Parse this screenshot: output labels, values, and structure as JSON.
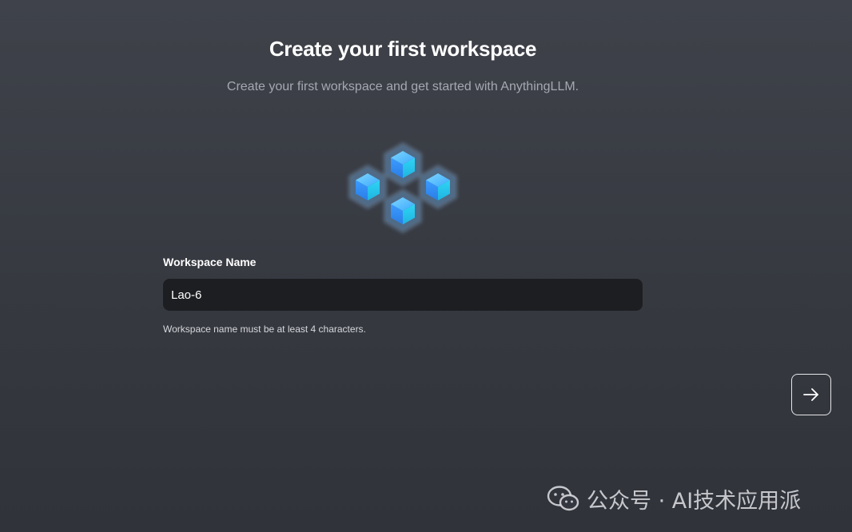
{
  "header": {
    "title": "Create your first workspace",
    "subtitle": "Create your first workspace and get started with AnythingLLM."
  },
  "form": {
    "label": "Workspace Name",
    "value": "Lao-6",
    "hint": "Workspace name must be at least 4 characters."
  },
  "navigation": {
    "next_icon": "arrow-right-icon"
  },
  "illustration": {
    "icon": "cubes-icon",
    "color": "#3ab0ff"
  },
  "watermark": {
    "icon": "wechat-icon",
    "text": "公众号 · AI技术应用派"
  }
}
